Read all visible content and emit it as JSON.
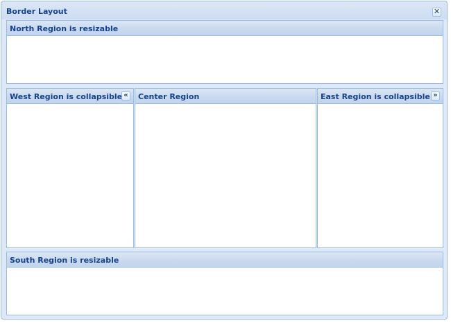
{
  "window": {
    "title": "Border Layout",
    "close_glyph": "✕"
  },
  "regions": {
    "north": {
      "title": "North Region is resizable"
    },
    "west": {
      "title": "West Region is collapsible",
      "collapse_glyph": "«"
    },
    "center": {
      "title": "Center Region"
    },
    "east": {
      "title": "East Region is collapsible",
      "collapse_glyph": "»"
    },
    "south": {
      "title": "South Region is resizable"
    }
  },
  "colors": {
    "title_text": "#15428b",
    "border": "#99bbe8",
    "frame_bg": "#dfe8f6"
  }
}
